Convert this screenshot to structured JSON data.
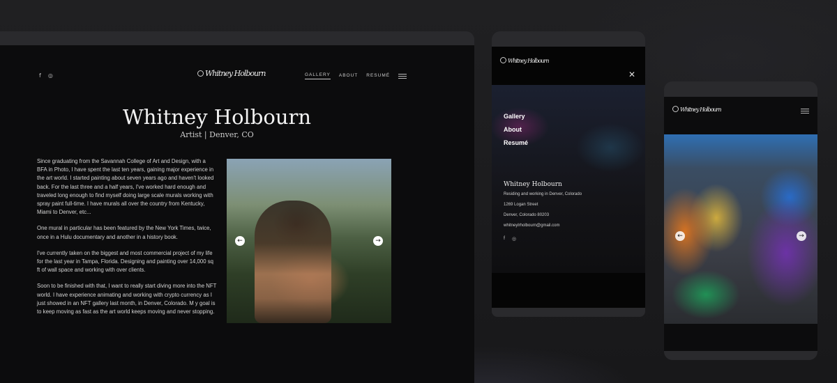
{
  "brand": {
    "logo_text": "Whitney Holbourn"
  },
  "desktop": {
    "social": {
      "facebook": "f",
      "instagram": "◎"
    },
    "nav": {
      "gallery": "GALLERY",
      "about": "ABOUT",
      "resume": "RESUMÉ"
    },
    "hero": {
      "name": "Whitney Holbourn",
      "subtitle": "Artist | Denver, CO"
    },
    "bio": [
      "Since graduating from the Savannah College of Art and Design, with a BFA in Photo, I have spent the last ten years, gaining major experience in the art world. I started painting about seven years ago and haven't looked back. For the last three and a half years, I've worked hard enough and traveled long enough to find myself doing large scale murals working with spray paint full-time. I have murals all over the country from Kentucky, Miami to Denver, etc...",
      "One mural in particular has been featured by the New York Times, twice, once in a Hulu documentary and another in a history book.",
      "I've currently taken on the biggest and most commercial project of my life for the last year in Tampa, Florida. Designing and painting over 14,000 sq ft of wall space and working with over clients.",
      "Soon to be finished with that, I want to really start diving more into the NFT world. I have experience animating and working with crypto currency as I just showed in an NFT gallery last month, in Denver, Colorado. M y goal is to keep moving as fast as the art world keeps moving and never stopping."
    ],
    "slider": {
      "prev": "←",
      "next": "→"
    }
  },
  "tablet": {
    "close": "✕",
    "menu": [
      "Gallery",
      "About",
      "Resumé"
    ],
    "contact": {
      "name": "Whitney Holbourn",
      "line1": "Residing and working in Denver, Colorado",
      "street": "1269 Logan Street",
      "city": "Denver, Colorado 80203",
      "email": "whitneylrholbourn@gmail.com"
    },
    "social": {
      "facebook": "f",
      "instagram": "◎"
    }
  },
  "phone": {
    "slider": {
      "prev": "←",
      "next": "→"
    }
  }
}
